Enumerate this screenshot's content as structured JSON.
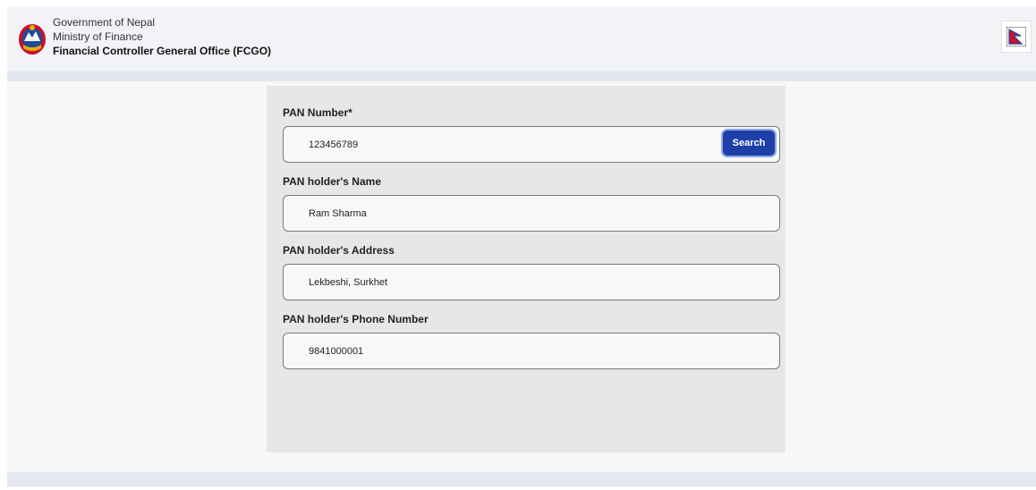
{
  "header": {
    "line1": "Government of Nepal",
    "line2": "Ministry of Finance",
    "line3": "Financial Controller General Office (FCGO)",
    "emblem_icon": "nepal-emblem-icon",
    "language_icon": "nepal-flag-icon"
  },
  "form": {
    "pan_number": {
      "label": "PAN Number*",
      "value": "123456789"
    },
    "search_label": "Search",
    "name": {
      "label": "PAN holder's Name",
      "value": "Ram Sharma"
    },
    "address": {
      "label": "PAN holder's Address",
      "value": "Lekbeshi, Surkhet"
    },
    "phone": {
      "label": "PAN holder's Phone Number",
      "value": "9841000001"
    }
  },
  "colors": {
    "primary_button": "#1f3fa8",
    "header_bg": "#f1f3f7",
    "card_bg": "#e6e7e9"
  }
}
